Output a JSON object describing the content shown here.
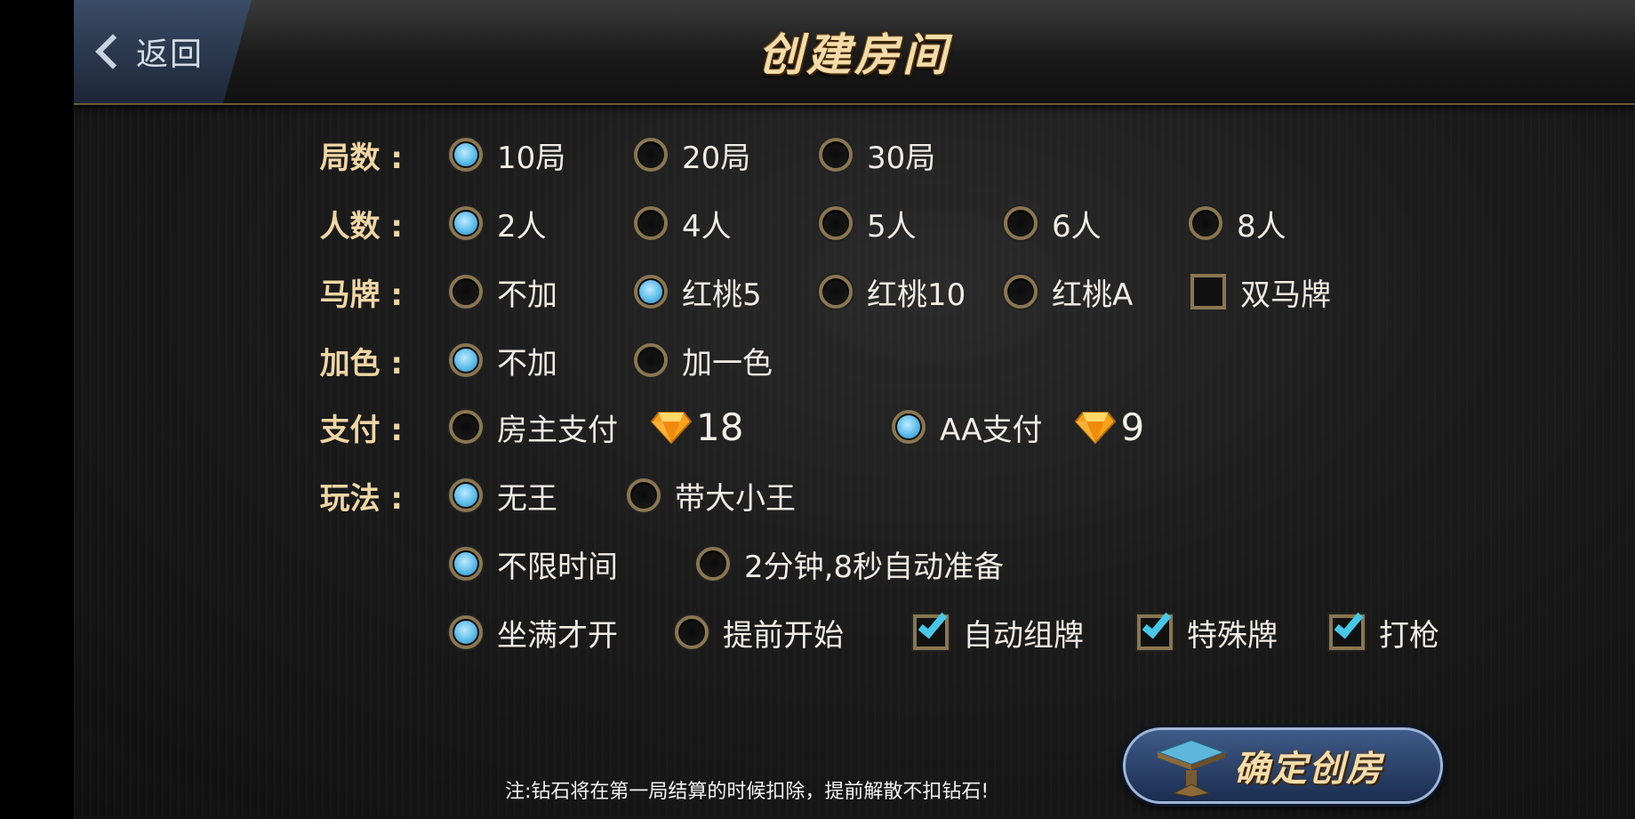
{
  "header": {
    "back_label": "返回",
    "title": "创建房间"
  },
  "rows": {
    "rounds": {
      "label": "局数 :",
      "options": [
        "10局",
        "20局",
        "30局"
      ],
      "selected": "10局"
    },
    "players": {
      "label": "人数 :",
      "options": [
        "2人",
        "4人",
        "5人",
        "6人",
        "8人"
      ],
      "selected": "2人"
    },
    "horse_card": {
      "label": "马牌 :",
      "options": [
        "不加",
        "红桃5",
        "红桃10",
        "红桃A"
      ],
      "selected": "红桃5",
      "double_horse_label": "双马牌",
      "double_horse_checked": false
    },
    "add_color": {
      "label": "加色 :",
      "options": [
        "不加",
        "加一色"
      ],
      "selected": "不加"
    },
    "payment": {
      "label": "支付 :",
      "owner_label": "房主支付",
      "owner_cost": "18",
      "aa_label": "AA支付",
      "aa_cost": "9",
      "selected": "AA支付"
    },
    "gameplay": {
      "label": "玩法 :",
      "jokers": [
        "无王",
        "带大小王"
      ],
      "jokers_selected": "无王",
      "time": [
        "不限时间",
        "2分钟,8秒自动准备"
      ],
      "time_selected": "不限时间",
      "start": [
        "坐满才开",
        "提前开始"
      ],
      "start_selected": "坐满才开",
      "checks": [
        {
          "label": "自动组牌",
          "checked": true
        },
        {
          "label": "特殊牌",
          "checked": true
        },
        {
          "label": "打枪",
          "checked": true
        }
      ]
    }
  },
  "footer": {
    "note": "注:钻石将在第一局结算的时候扣除，提前解散不扣钻石!",
    "confirm_label": "确定创房"
  },
  "colors": {
    "accent_gold": "#f0d6a4",
    "radio_on": "#5bbcea",
    "check_on": "#45c8e6",
    "button_blue": "#3f5b88"
  },
  "icons": {
    "back": "chevron-left-icon",
    "gem": "diamond-icon",
    "confirm": "table-icon"
  }
}
